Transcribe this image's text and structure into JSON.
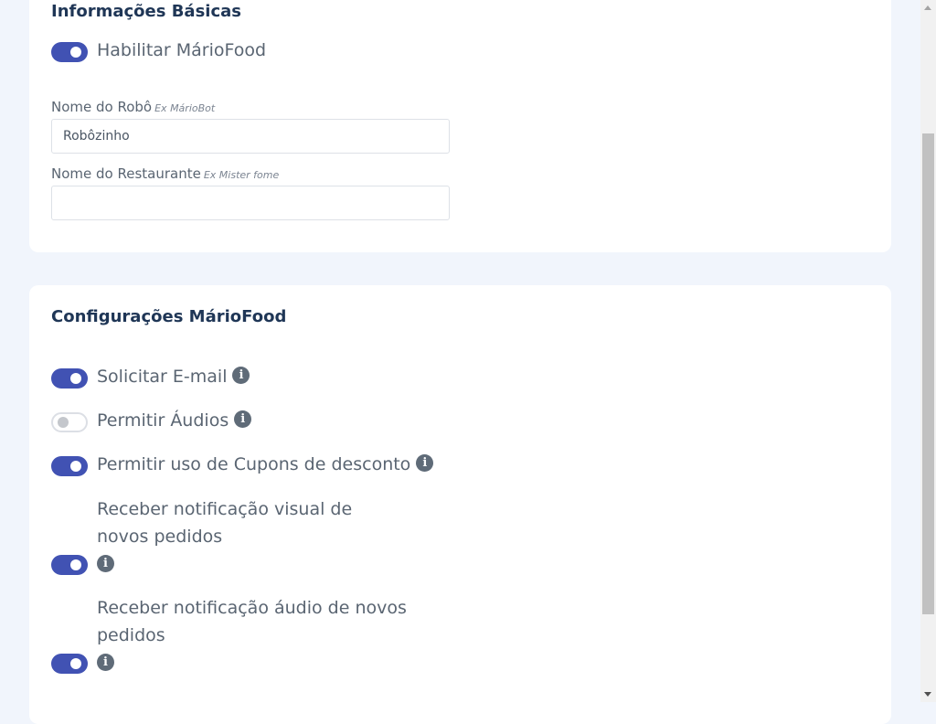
{
  "basic_info": {
    "title": "Informações Básicas",
    "enable_toggle": {
      "label": "Habilitar MárioFood",
      "checked": true
    },
    "robot_name": {
      "label": "Nome do Robô",
      "hint": "Ex MárioBot",
      "value": "Robôzinho",
      "placeholder": ""
    },
    "restaurant_name": {
      "label": "Nome do Restaurante",
      "hint": "Ex Mister fome",
      "value": "",
      "placeholder": ""
    }
  },
  "settings": {
    "title": "Configurações MárioFood",
    "options": [
      {
        "label": "Solicitar E-mail",
        "checked": true
      },
      {
        "label": "Permitir Áudios",
        "checked": false
      },
      {
        "label": "Permitir uso de Cupons de desconto",
        "checked": true
      },
      {
        "label": "Receber notificação visual de novos pedidos",
        "checked": true
      },
      {
        "label": "Receber notificação áudio de novos pedidos",
        "checked": true
      }
    ]
  },
  "icons": {
    "info": "info-circle-icon",
    "info_glyph": "i"
  },
  "colors": {
    "accent": "#4152b3",
    "background": "#f1f5fc",
    "card": "#ffffff",
    "title": "#1f3656"
  }
}
